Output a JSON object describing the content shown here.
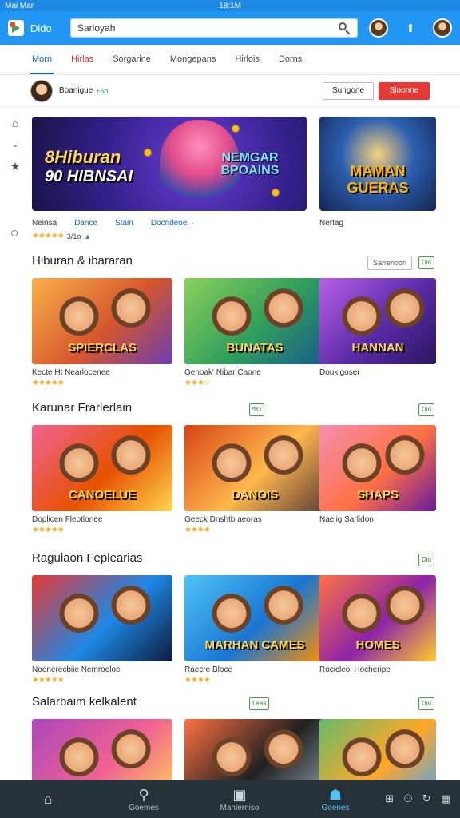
{
  "status_bar": {
    "left": "Mai Mar",
    "center": "18:1M"
  },
  "top_bar": {
    "brand": "Dido",
    "search_value": "Sarloyah"
  },
  "tabs": [
    {
      "label": "Morn",
      "state": "active"
    },
    {
      "label": "Hirlas",
      "state": "red"
    },
    {
      "label": "Sorgarine",
      "state": "normal"
    },
    {
      "label": "Mongepans",
      "state": "normal"
    },
    {
      "label": "Hirlois",
      "state": "normal"
    },
    {
      "label": "Dorns",
      "state": "normal"
    }
  ],
  "user_bar": {
    "name": "Bbanigue",
    "badge": "±6o",
    "button_outline": "Sungone",
    "button_red": "Sloonne"
  },
  "hero": {
    "banner1_title": "8Hiburan",
    "banner1_subtitle": "90 HIBNSAI",
    "banner1_right": "NEMGAR BPOAINS",
    "banner2_title": "MAMAN GUERAS",
    "meta_links": [
      "Neinsa",
      "Dance",
      "Stain",
      "Docndeoei ·"
    ],
    "meta_rating_text": "3/1o",
    "meta_right": "Nertag"
  },
  "sections": [
    {
      "title": "Hiburan & ibararan",
      "link": "Sarrenoon",
      "tag": "Dio",
      "cards": [
        {
          "title": "Kecte Ht Nearlocenee",
          "thumb_text": "SPIERCLAS",
          "stars": "★★★★★",
          "colors": [
            "#f8b04a",
            "#d5562d",
            "#6b3fb0"
          ]
        },
        {
          "title": "Genoak' Nibar Caone",
          "thumb_text": "BUNATAS",
          "stars": "★★★☆",
          "colors": [
            "#8cd05a",
            "#2f9e5c",
            "#1a5c8c"
          ]
        },
        {
          "title": "Doukigoser",
          "thumb_text": "HANNAN",
          "stars": "",
          "colors": [
            "#b860e8",
            "#5a2ba8",
            "#2b1660"
          ]
        }
      ]
    },
    {
      "title": "Karunar Frarlerlain",
      "link": "",
      "tag": "ªЮ",
      "tag_right": "Dio",
      "cards": [
        {
          "title": "Doplicen Fleotlonee",
          "thumb_text": "CANOELUE",
          "stars": "★★★★★",
          "colors": [
            "#f06292",
            "#e65100",
            "#ffd54f"
          ]
        },
        {
          "title": "Geeck Dnshtb aeoras",
          "thumb_text": "DANOIS",
          "stars": "★★★★",
          "colors": [
            "#d84315",
            "#ffb74d",
            "#5d4037"
          ]
        },
        {
          "title": "Naelig Sarlidon",
          "thumb_text": "SHAPS",
          "stars": "",
          "colors": [
            "#f48fb1",
            "#ff7043",
            "#6a1b9a"
          ]
        }
      ]
    },
    {
      "title": "Ragulaon Feplearias",
      "link": "",
      "tag": "Dio",
      "cards": [
        {
          "title": "Noenerecbiie Nemroeloe",
          "thumb_text": "",
          "stars": "★★★★★",
          "colors": [
            "#e53935",
            "#1e88e5",
            "#0d1b3e"
          ]
        },
        {
          "title": "Raecre Bloce",
          "thumb_text": "MARHAN CAMES",
          "stars": "★★★★",
          "colors": [
            "#4fc3f7",
            "#1976d2",
            "#ff8f00"
          ]
        },
        {
          "title": "Rocicleoi Hocheripe",
          "thumb_text": "HOMES",
          "stars": "",
          "colors": [
            "#ff7043",
            "#8e24aa",
            "#ffca28"
          ]
        }
      ]
    },
    {
      "title": "Salarbaim kelkalent",
      "link": "",
      "tag": "Leas",
      "tag_right": "Dio",
      "cards": [
        {
          "title": "",
          "thumb_text": "",
          "stars": "",
          "colors": [
            "#ab47bc",
            "#f06292",
            "#ffd54f"
          ]
        },
        {
          "title": "",
          "thumb_text": "",
          "stars": "",
          "colors": [
            "#ff7043",
            "#212121",
            "#90a4ae"
          ]
        },
        {
          "title": "",
          "thumb_text": "",
          "stars": "",
          "colors": [
            "#66bb6a",
            "#ffa726",
            "#42a5f5"
          ]
        }
      ]
    }
  ],
  "bottom_nav": [
    {
      "label": "",
      "icon": "home-icon",
      "glyph": "⌂",
      "active": false
    },
    {
      "label": "Goemes",
      "icon": "search-icon",
      "glyph": "⚲",
      "active": false
    },
    {
      "label": "Mahlerniso",
      "icon": "profile-card-icon",
      "glyph": "▣",
      "active": false
    },
    {
      "label": "Goenes",
      "icon": "games-icon",
      "glyph": "☗",
      "active": true
    }
  ],
  "bottom_extra_icons": [
    "grid-icon",
    "people-icon",
    "refresh-icon",
    "calendar-icon"
  ],
  "colors": {
    "primary": "#2196f3",
    "accent_red": "#e53935",
    "star": "#f9a825",
    "nav_bg": "#263238"
  }
}
